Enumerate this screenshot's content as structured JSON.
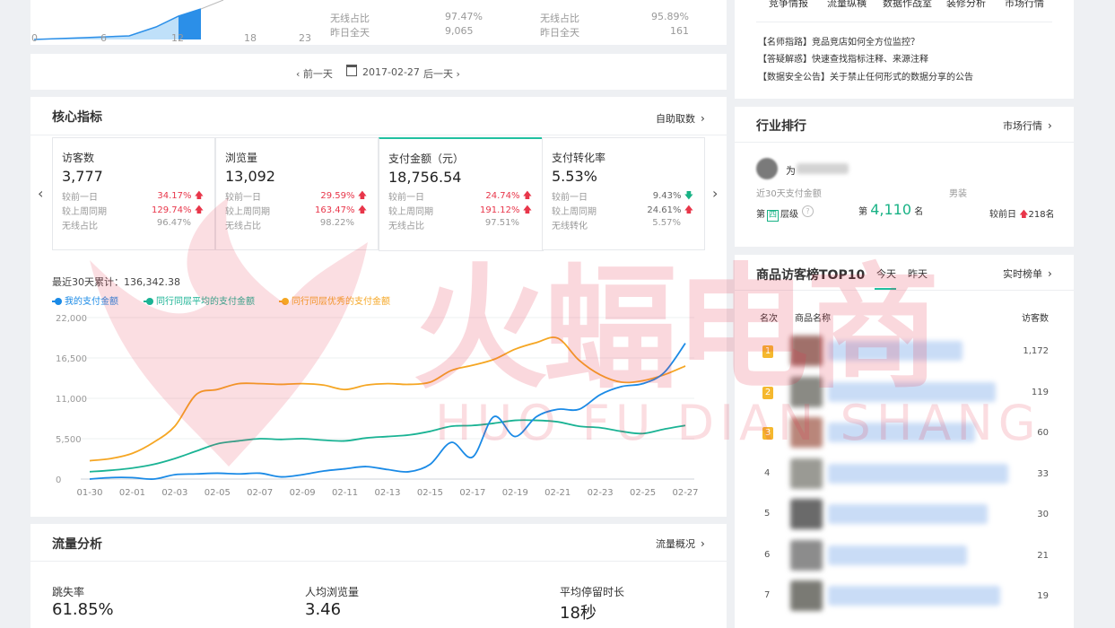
{
  "top_left": {
    "mini_ticks": [
      "0",
      "6",
      "12",
      "18",
      "23"
    ],
    "stats": [
      {
        "label": "无线占比",
        "value": "97.47%"
      },
      {
        "label": "昨日全天",
        "value": "9,065"
      },
      {
        "label": "无线占比",
        "value": "95.89%"
      },
      {
        "label": "昨日全天",
        "value": "161"
      }
    ]
  },
  "date_nav": {
    "prev": "前一天",
    "date": "2017-02-27",
    "next": "后一天"
  },
  "core": {
    "title": "核心指标",
    "link": "自助取数",
    "kpis": [
      {
        "name": "访客数",
        "value": "3,777",
        "rows": [
          {
            "label": "较前一日",
            "value": "34.17%",
            "dir": "up"
          },
          {
            "label": "较上周同期",
            "value": "129.74%",
            "dir": "up"
          },
          {
            "label": "无线占比",
            "value": "96.47%"
          }
        ]
      },
      {
        "name": "浏览量",
        "value": "13,092",
        "rows": [
          {
            "label": "较前一日",
            "value": "29.59%",
            "dir": "up"
          },
          {
            "label": "较上周同期",
            "value": "163.47%",
            "dir": "up"
          },
          {
            "label": "无线占比",
            "value": "98.22%"
          }
        ]
      },
      {
        "name": "支付金额（元）",
        "value": "18,756.54",
        "rows": [
          {
            "label": "较前一日",
            "value": "24.74%",
            "dir": "up"
          },
          {
            "label": "较上周同期",
            "value": "191.12%",
            "dir": "up"
          },
          {
            "label": "无线占比",
            "value": "97.51%"
          }
        ]
      },
      {
        "name": "支付转化率",
        "value": "5.53%",
        "rows": [
          {
            "label": "较前一日",
            "value": "9.43%",
            "dir": "down"
          },
          {
            "label": "较上周同期",
            "value": "24.61%",
            "dir": "up"
          },
          {
            "label": "无线转化",
            "value": "5.57%"
          }
        ]
      }
    ]
  },
  "chart_data": {
    "type": "line",
    "summary": "最近30天累计：136,342.38",
    "ylim": [
      0,
      22000
    ],
    "yticks": [
      "0",
      "5,500",
      "11,000",
      "16,500",
      "22,000"
    ],
    "x_ticks": [
      "01-30",
      "02-01",
      "02-03",
      "02-05",
      "02-07",
      "02-09",
      "02-11",
      "02-13",
      "02-15",
      "02-17",
      "02-19",
      "02-21",
      "02-23",
      "02-25",
      "02-27"
    ],
    "x": [
      "01-30",
      "01-31",
      "02-01",
      "02-02",
      "02-03",
      "02-04",
      "02-05",
      "02-06",
      "02-07",
      "02-08",
      "02-09",
      "02-10",
      "02-11",
      "02-12",
      "02-13",
      "02-14",
      "02-15",
      "02-16",
      "02-17",
      "02-18",
      "02-19",
      "02-20",
      "02-21",
      "02-22",
      "02-23",
      "02-24",
      "02-25",
      "02-26",
      "02-27"
    ],
    "series": [
      {
        "name": "我的支付金额",
        "color": "#1a8ae6",
        "values": [
          0,
          200,
          200,
          0,
          600,
          700,
          800,
          700,
          800,
          300,
          600,
          1100,
          1400,
          1700,
          1300,
          1000,
          2000,
          5000,
          3000,
          8500,
          5800,
          8500,
          9500,
          9500,
          11500,
          12600,
          13000,
          14500,
          18500
        ]
      },
      {
        "name": "同行同层平均的支付金额",
        "color": "#1ab394",
        "values": [
          1000,
          1200,
          1500,
          2000,
          2800,
          3800,
          4800,
          5200,
          5500,
          5400,
          5500,
          5300,
          5200,
          5600,
          5800,
          6000,
          6500,
          7200,
          7300,
          7600,
          8000,
          8000,
          7800,
          7200,
          7000,
          6500,
          6200,
          6800,
          7300
        ]
      },
      {
        "name": "同行同层优秀的支付金额",
        "color": "#f5a623",
        "values": [
          2500,
          2800,
          3500,
          5000,
          7200,
          11500,
          12200,
          13000,
          13000,
          12900,
          13000,
          12800,
          12200,
          12800,
          13000,
          12900,
          13200,
          14800,
          15500,
          16300,
          17700,
          18600,
          19200,
          16200,
          14200,
          13200,
          13400,
          14200,
          15400
        ]
      }
    ]
  },
  "traffic": {
    "title": "流量分析",
    "link": "流量概况",
    "metrics": [
      {
        "label": "跳失率",
        "value": "61.85%"
      },
      {
        "label": "人均浏览量",
        "value": "3.46"
      },
      {
        "label": "平均停留时长",
        "value": "18秒"
      }
    ]
  },
  "top_right": {
    "tabs": [
      "竞争情报",
      "流量纵横",
      "数据作战室",
      "装修分析",
      "市场行情"
    ],
    "notices": [
      "【名师指路】竞品竞店如何全方位监控？",
      "【答疑解惑】快速查找指标注释、来源注释",
      "【数据安全公告】关于禁止任何形式的数据分享的公告"
    ]
  },
  "industry": {
    "title": "行业排行",
    "link": "市场行情",
    "shop_prefix": "为",
    "caption": "近30天支付金额",
    "category": "男装",
    "level_pre": "第",
    "level_num": "四",
    "level_post": "层级",
    "rank_pre": "第",
    "rank_num": "4,110",
    "rank_post": "名",
    "prev_label": "较前日",
    "prev_value": "218名"
  },
  "top10": {
    "title": "商品访客榜TOP10",
    "tabs": [
      "今天",
      "昨天"
    ],
    "link": "实时榜单",
    "headers": [
      "名次",
      "商品名称",
      "访客数"
    ],
    "rows": [
      {
        "rank": "1",
        "visitors": "1,172",
        "medal": true
      },
      {
        "rank": "2",
        "visitors": "119",
        "medal": true
      },
      {
        "rank": "3",
        "visitors": "60",
        "medal": true
      },
      {
        "rank": "4",
        "visitors": "33",
        "medal": false
      },
      {
        "rank": "5",
        "visitors": "30",
        "medal": false
      },
      {
        "rank": "6",
        "visitors": "21",
        "medal": false
      },
      {
        "rank": "7",
        "visitors": "19",
        "medal": false
      }
    ]
  },
  "watermark": {
    "cn": "火蝠电商",
    "en": "HUO FU DIAN SHANG"
  }
}
